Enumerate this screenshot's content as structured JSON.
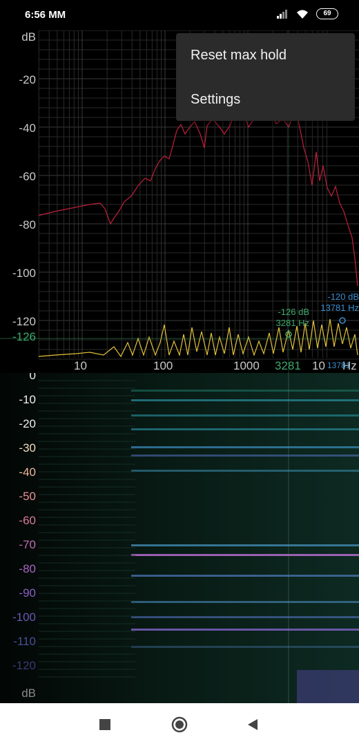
{
  "status_bar": {
    "time": "6:56 MM",
    "battery": "69",
    "icons": [
      "signal-icon",
      "wifi-icon",
      "battery-icon"
    ]
  },
  "spectrum": {
    "y_unit": "dB",
    "y_ticks": [
      "-20",
      "-40",
      "-60",
      "-80",
      "-100",
      "-120"
    ],
    "x_ticks": [
      "10",
      "100",
      "1000"
    ],
    "x_tick_partial": "10",
    "x_unit_tail": "Hz",
    "cursor_db_left": "-126",
    "cursor_freq_left": "3281",
    "cursor_freq_right": "13781",
    "marker_left": {
      "db": "-126 dB",
      "hz": "3281 Hz"
    },
    "marker_right": {
      "db": "-120 dB",
      "hz": "13781 Hz"
    },
    "colors": {
      "max_hold": "#c0203a",
      "live": "#e4c238",
      "marker_left": "#3fa86a",
      "marker_right": "#3b8fd0"
    }
  },
  "spectrogram": {
    "labels": [
      "0",
      "-10",
      "-20",
      "-30",
      "-40",
      "-50",
      "-60",
      "-70",
      "-80",
      "-90",
      "-100",
      "-110",
      "-120",
      "dB"
    ]
  },
  "menu": {
    "items": [
      "Reset max hold",
      "Settings"
    ]
  },
  "nav": {
    "icons": [
      "recents-icon",
      "home-icon",
      "back-icon"
    ]
  }
}
